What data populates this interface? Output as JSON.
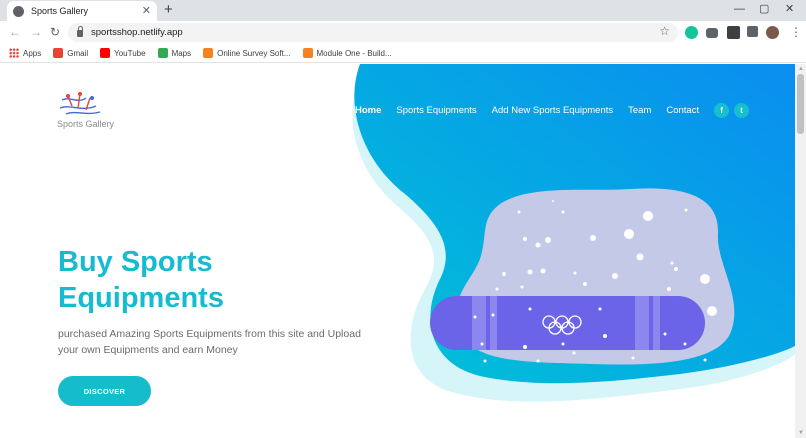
{
  "browser": {
    "tab_title": "Sports Gallery",
    "tab_close": "✕",
    "new_tab": "+",
    "url": "sportsshop.netlify.app",
    "window_controls": [
      "—",
      "▢",
      "✕"
    ],
    "bookmarks": [
      {
        "label": "Apps",
        "icon": "apps-grid-icon"
      },
      {
        "label": "Gmail",
        "icon": "gmail-icon",
        "color": "#ea4335"
      },
      {
        "label": "YouTube",
        "icon": "youtube-icon",
        "color": "#ff0000"
      },
      {
        "label": "Maps",
        "icon": "maps-icon",
        "color": "#34a853"
      },
      {
        "label": "Online Survey Soft...",
        "icon": "cube-icon",
        "color": "#f58220"
      },
      {
        "label": "Module One - Build...",
        "icon": "cube-icon",
        "color": "#f58220"
      }
    ]
  },
  "site": {
    "logo_text": "Sports Gallery",
    "nav": [
      "Home",
      "Sports Equipments",
      "Add New Sports Equipments",
      "Team",
      "Contact"
    ],
    "social": {
      "facebook": "f",
      "twitter": "t"
    },
    "hero_title": "Buy Sports Equipments",
    "hero_subtitle": "purchased Amazing Sports Equipments from this site and Upload your own Equipments and earn Money",
    "cta": "DISCOVER"
  },
  "colors": {
    "accent": "#17bbcf",
    "blob_start": "#00c3d6",
    "blob_end": "#0a8df0",
    "board": "#6b63e8"
  }
}
